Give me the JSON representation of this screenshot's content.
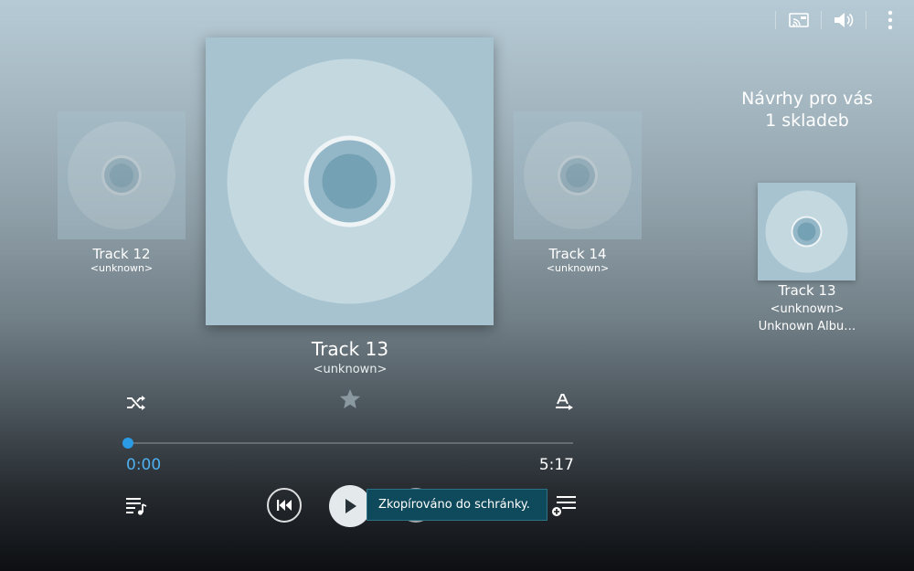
{
  "app": {
    "accent_color": "#2b9be6",
    "toast_color": "#0f4a5c"
  },
  "topbar": {
    "icons": [
      "screen-mirror-icon",
      "volume-icon",
      "overflow-menu-icon"
    ]
  },
  "carousel": {
    "previous": {
      "title": "Track 12",
      "artist": "<unknown>"
    },
    "current": {
      "title": "Track 13",
      "artist": "<unknown>"
    },
    "next": {
      "title": "Track 14",
      "artist": "<unknown>"
    }
  },
  "suggestions": {
    "heading_line1": "Návrhy pro vás",
    "heading_line2": "1 skladeb",
    "item": {
      "title": "Track 13",
      "artist": "<unknown>",
      "album": "Unknown Albu…"
    }
  },
  "player": {
    "elapsed": "0:00",
    "duration": "5:17",
    "progress_fraction": 0.0,
    "favorite": false
  },
  "toast": {
    "message": "Zkopírováno do schránky."
  }
}
